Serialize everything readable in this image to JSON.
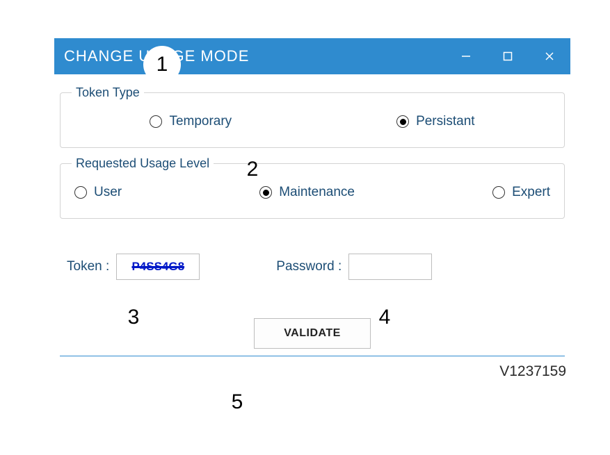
{
  "window": {
    "title": "CHANGE USAGE MODE"
  },
  "groups": {
    "tokenType": {
      "legend": "Token Type",
      "options": {
        "temporary": "Temporary",
        "persistant": "Persistant"
      },
      "selected": "persistant"
    },
    "usageLevel": {
      "legend": "Requested Usage Level",
      "options": {
        "user": "User",
        "maintenance": "Maintenance",
        "expert": "Expert"
      },
      "selected": "maintenance"
    }
  },
  "fields": {
    "tokenLabel": "Token :",
    "tokenValue": "P4SS4G8",
    "passwordLabel": "Password :",
    "passwordValue": ""
  },
  "buttons": {
    "validate": "VALIDATE"
  },
  "footerCode": "V1237159",
  "annotations": {
    "n1": "1",
    "n2": "2",
    "n3": "3",
    "n4": "4",
    "n5": "5"
  }
}
